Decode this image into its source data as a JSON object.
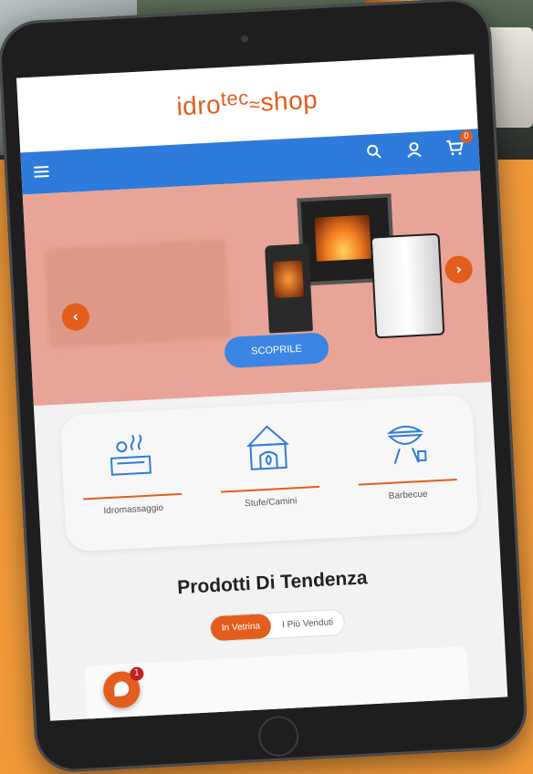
{
  "brand": {
    "name_part1": "idro",
    "name_part2": "tec",
    "name_part3": "shop"
  },
  "header": {
    "cart_count": "0"
  },
  "banner": {
    "cta_label": "SCOPRILE"
  },
  "categories": [
    {
      "label": "Idromassaggio"
    },
    {
      "label": "Stufe/Camini"
    },
    {
      "label": "Barbecue"
    }
  ],
  "section": {
    "title": "Prodotti Di Tendenza",
    "tabs": [
      {
        "label": "In Vetrina",
        "active": true
      },
      {
        "label": "I Più Venduti",
        "active": false
      }
    ]
  },
  "chat": {
    "badge": "1"
  },
  "colors": {
    "accent": "#e35d1c",
    "nav": "#2f7bdc",
    "background": "#f19a3a"
  }
}
